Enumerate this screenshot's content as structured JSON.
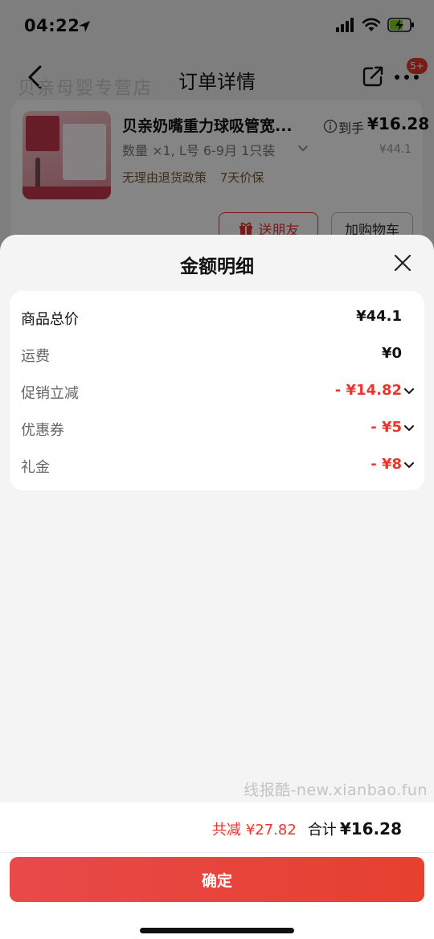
{
  "status_bar": {
    "time": "04:22"
  },
  "nav": {
    "title": "订单详情",
    "badge": "5+"
  },
  "background": {
    "faded_shop_text": "贝亲母婴专营店"
  },
  "product": {
    "title": "贝亲奶嘴重力球吸管宽...",
    "spec": "数量 ×1, L号 6-9月 1只装",
    "policy_return": "无理由退货政策",
    "policy_price": "7天价保",
    "price_label": "到手",
    "price_value": "¥16.28",
    "price_original": "¥44.1",
    "gift_button": "送朋友",
    "cart_button": "加购物车"
  },
  "sheet": {
    "title": "金额明细",
    "rows": [
      {
        "label": "商品总价",
        "value": "¥44.1"
      },
      {
        "label": "运费",
        "value": "¥0"
      },
      {
        "label": "促销立减",
        "value": "- ¥14.82"
      },
      {
        "label": "优惠券",
        "value": "- ¥5"
      },
      {
        "label": "礼金",
        "value": "- ¥8"
      }
    ]
  },
  "watermark": "线报酷-new.xianbao.fun",
  "summary": {
    "saved_label": "共减",
    "saved_value": "¥27.82",
    "total_label": "合计",
    "total_value": "¥16.28"
  },
  "confirm_button": "确定",
  "colors": {
    "accent_red": "#e8362c",
    "overlay": "rgba(0,0,0,0.48)"
  }
}
